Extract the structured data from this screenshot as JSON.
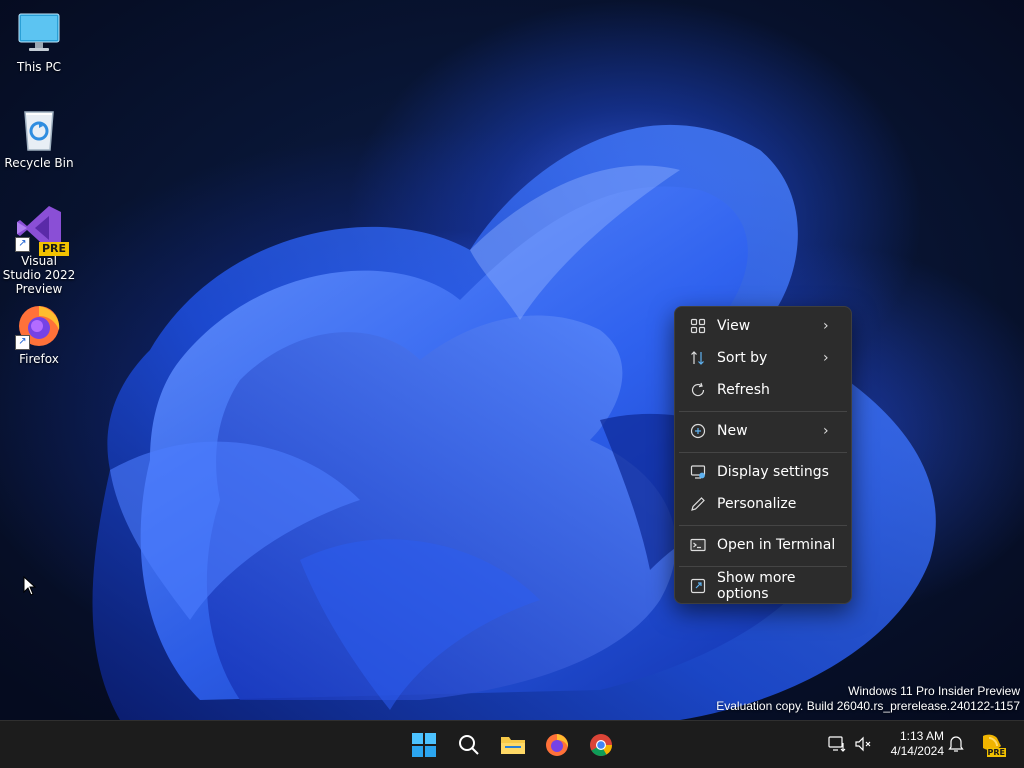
{
  "desktop": {
    "icons": [
      {
        "label": "This PC",
        "icon": "monitor-icon"
      },
      {
        "label": "Recycle Bin",
        "icon": "recycle-bin-icon"
      },
      {
        "label": "Visual Studio 2022 Preview",
        "icon": "visual-studio-icon",
        "badge": "PRE"
      },
      {
        "label": "Firefox",
        "icon": "firefox-icon"
      }
    ]
  },
  "context_menu": {
    "items": [
      {
        "label": "View",
        "icon": "grid-view-icon",
        "submenu": true
      },
      {
        "label": "Sort by",
        "icon": "sort-icon",
        "submenu": true
      },
      {
        "label": "Refresh",
        "icon": "refresh-icon",
        "submenu": false
      },
      {
        "label": "New",
        "icon": "plus-circle-icon",
        "submenu": true
      },
      {
        "label": "Display settings",
        "icon": "display-settings-icon",
        "submenu": false
      },
      {
        "label": "Personalize",
        "icon": "pen-icon",
        "submenu": false
      },
      {
        "label": "Open in Terminal",
        "icon": "terminal-icon",
        "submenu": false
      },
      {
        "label": "Show more options",
        "icon": "share-icon",
        "submenu": false
      }
    ],
    "chevron": "›"
  },
  "watermark": {
    "line1": "Windows 11 Pro Insider Preview",
    "line2": "Evaluation copy. Build 26040.rs_prerelease.240122-1157"
  },
  "taskbar": {
    "apps": [
      "start-icon",
      "search-icon",
      "file-explorer-icon",
      "firefox-icon",
      "chrome-icon"
    ],
    "clock": {
      "time": "1:13 AM",
      "date": "4/14/2024"
    },
    "tray_badge": "PRE"
  },
  "colors": {
    "menu_bg": "#2c2c2c",
    "taskbar_bg": "#1c1c1c",
    "windows_blue": "#0078d4"
  }
}
